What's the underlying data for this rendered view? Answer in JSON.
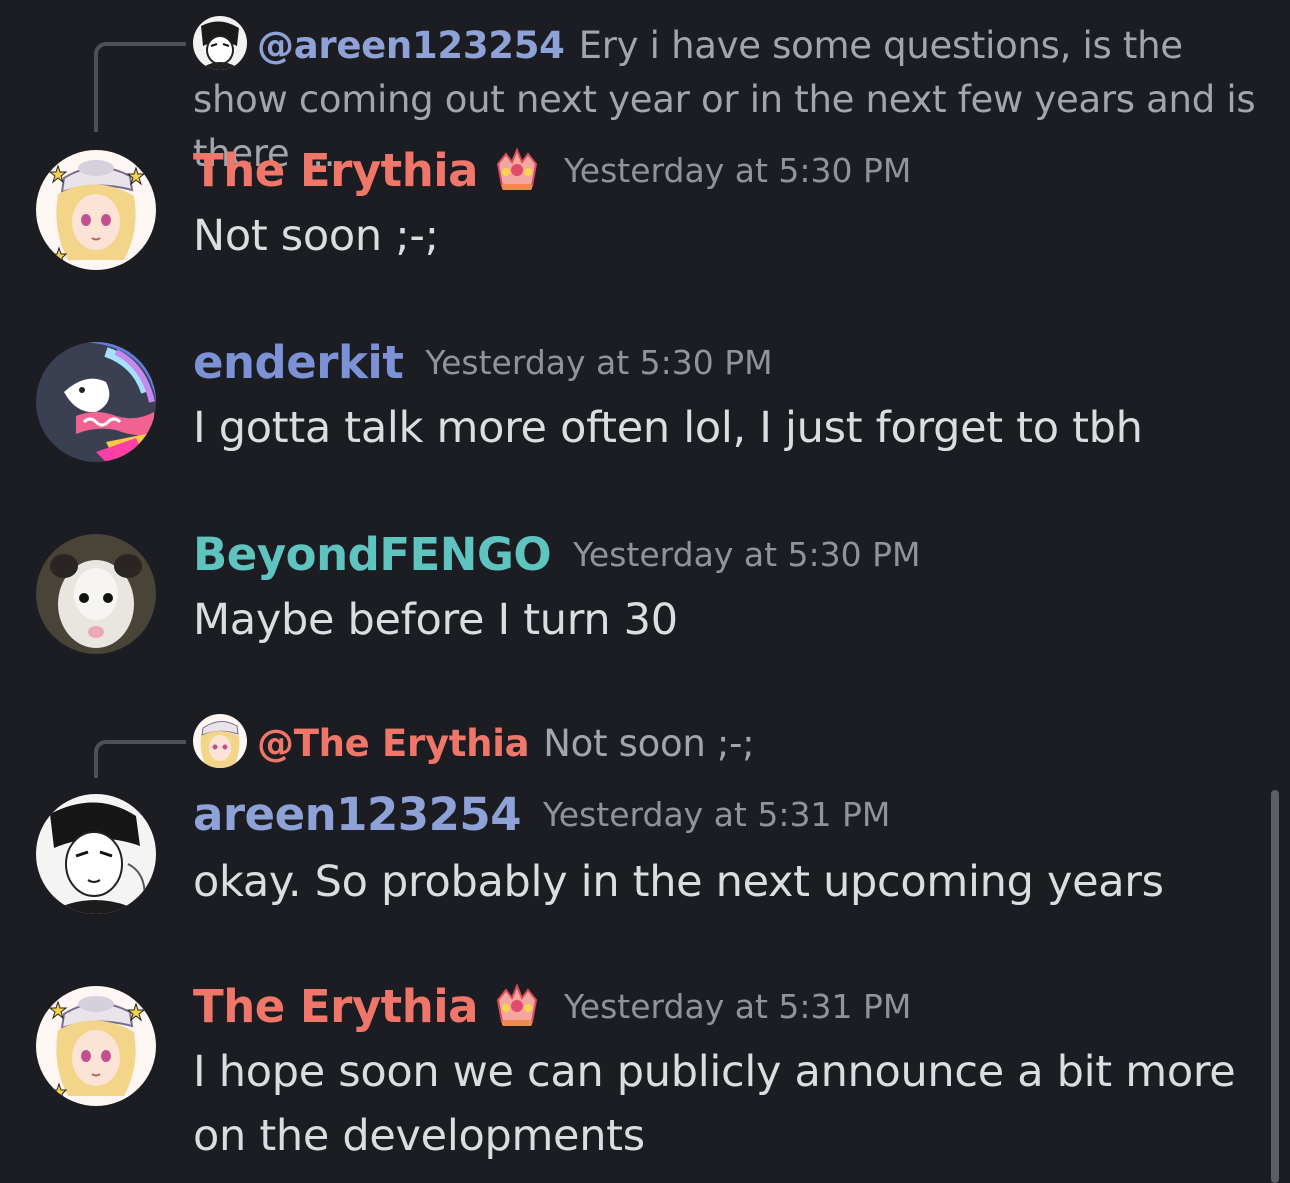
{
  "colors": {
    "background": "#1c1d22",
    "erythia_name": "#f0766a",
    "enderkit_name": "#7d92d6",
    "beyond_name": "#5fc3bf",
    "areen_name": "#8ea2d8",
    "timestamp": "#8f939b",
    "message_text": "#dbdee1"
  },
  "messages": [
    {
      "reply": {
        "mention": "@areen123254",
        "mention_color": "#8ea2d8",
        "text": "Ery i have some questions, is the show coming out next year or in the next few years and is there ..."
      },
      "author": "The Erythia",
      "badge_icon": "crown-role-icon",
      "timestamp": "Yesterday at 5:30 PM",
      "content": "Not soon ;-;"
    },
    {
      "author": "enderkit",
      "timestamp": "Yesterday at 5:30 PM",
      "content": "I gotta talk more often lol, I just forget to tbh"
    },
    {
      "author": "BeyondFENGO",
      "timestamp": "Yesterday at 5:30 PM",
      "content": "Maybe before I turn 30"
    },
    {
      "reply": {
        "mention": "@The Erythia",
        "mention_color": "#f0766a",
        "text": "Not soon ;-;"
      },
      "author": "areen123254",
      "timestamp": "Yesterday at 5:31 PM",
      "content": "okay. So probably in the next upcoming years"
    },
    {
      "author": "The Erythia",
      "badge_icon": "crown-role-icon",
      "timestamp": "Yesterday at 5:31 PM",
      "content": "I hope soon we can publicly announce a bit more on the developments"
    }
  ]
}
